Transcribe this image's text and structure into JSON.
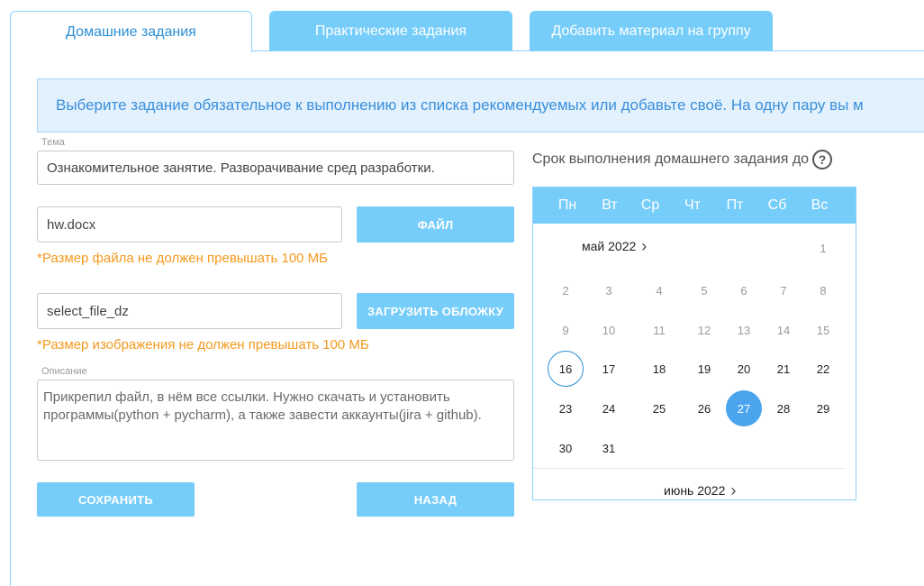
{
  "tabs": [
    {
      "label": "Домашние задания"
    },
    {
      "label": "Практические задания"
    },
    {
      "label": "Добавить материал на группу"
    }
  ],
  "info_text": "Выберите задание обязательное к выполнению из списка рекомендуемых или добавьте своё. На одну пару вы м",
  "form": {
    "topic_label": "Тема",
    "topic_value": "Ознакомительное занятие. Разворачивание сред разработки.",
    "file_value": "hw.docx",
    "file_button": "ФАЙЛ",
    "file_warning": "*Размер файла не должен превышать 100 МБ",
    "cover_value": "select_file_dz",
    "cover_button": "ЗАГРУЗИТЬ ОБЛОЖКУ",
    "cover_warning": "*Размер изображения не должен превышать 100 МБ",
    "description_label": "Описание",
    "description_value": "Прикрепил файл, в нём все ссылки. Нужно скачать и установить программы(python + pycharm), а также завести аккаунты(jira + github).",
    "save_button": "СОХРАНИТЬ",
    "back_button": "НАЗАД"
  },
  "deadline": {
    "label": "Срок выполнения домашнего задания до",
    "help_glyph": "?",
    "icon": "help-circle-icon"
  },
  "calendar": {
    "weekdays": [
      "Пн",
      "Вт",
      "Ср",
      "Чт",
      "Пт",
      "Сб",
      "Вс"
    ],
    "current_month": "май 2022",
    "next_month": "июнь 2022",
    "chevron": "›",
    "today": "16",
    "selected": "27",
    "weeks": [
      [
        "",
        "",
        "",
        "",
        "",
        "",
        "1"
      ],
      [
        "2",
        "3",
        "4",
        "5",
        "6",
        "7",
        "8"
      ],
      [
        "9",
        "10",
        "11",
        "12",
        "13",
        "14",
        "15"
      ],
      [
        "16",
        "17",
        "18",
        "19",
        "20",
        "21",
        "22"
      ],
      [
        "23",
        "24",
        "25",
        "26",
        "27",
        "28",
        "29"
      ],
      [
        "30",
        "31",
        "",
        "",
        "",
        "",
        ""
      ]
    ],
    "muted_rows": [
      0,
      1,
      2
    ]
  },
  "colors": {
    "accent": "#76cdfa",
    "tab_active_text": "#2a8fd6",
    "info_bg": "#e3f1fd",
    "warning": "#f59a1e",
    "selected_day": "#4aa5ee"
  }
}
